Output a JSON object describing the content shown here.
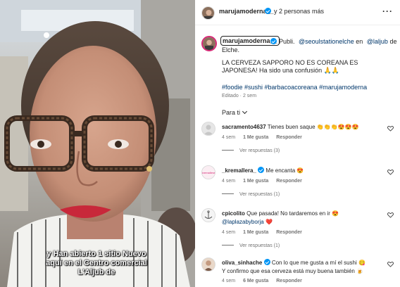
{
  "video": {
    "caption_lines": [
      "y Han abierto 1 sitio Nuevo",
      "aquí en el Centro comercial",
      "L'Aljub de"
    ]
  },
  "header": {
    "username": "marujamoderna__",
    "others": "y 2 personas más",
    "more_icon": "more-horizontal-icon"
  },
  "post": {
    "username": "marujamoderna__",
    "publi": "Publi.",
    "mention1": "@seoulstationelche",
    "en": "en",
    "mention2": "@laljub",
    "de": "de",
    "line2": "Elche.",
    "text": "LA CERVEZA SAPPORO NO ES COREANA ES JAPONESA! Ha sido una confusión 🙏🙏",
    "hashtags": "#foodie #sushi #barbacoacoreana #marujamoderna",
    "edited": "Editado · 2 sem"
  },
  "filter": {
    "label": "Para ti"
  },
  "comments": [
    {
      "username": "sacramento4637",
      "text": "Tienes buen saque 👏👏👏😍😍😍",
      "time": "4 sem",
      "likes": "1 Me gusta",
      "reply": "Responder",
      "replies": "Ver respuestas (3)",
      "avatar_color": "#e6e6e6"
    },
    {
      "username": "_kremallera_",
      "text": "Me encanta 😍",
      "time": "4 sem",
      "likes": "1 Me gusta",
      "reply": "Responder",
      "replies": "Ver respuestas (1)",
      "avatar_color": "#f9e6ef"
    },
    {
      "username": "cpicolito",
      "text": "Que pasada! No tardaremos en ir 😍",
      "mention": "@laplazabyborja",
      "mention_suffix": "❤️",
      "time": "4 sem",
      "likes": "1 Me gusta",
      "reply": "Responder",
      "replies": "Ver respuestas (1)",
      "avatar_color": "#f1f1f1"
    },
    {
      "username": "oliva_sinhache",
      "text": "Con lo que me gusta a mí el sushi 😋",
      "text2": "Y confirmo que esa cerveza está muy buena también 🍺",
      "time": "4 sem",
      "likes": "6 Me gusta",
      "reply": "Responder",
      "avatar_color": "#d9b8a0"
    }
  ],
  "colors": {
    "accent": "#0095f6",
    "link": "#00376b",
    "muted": "#737373",
    "story_ring": "#d62976"
  }
}
